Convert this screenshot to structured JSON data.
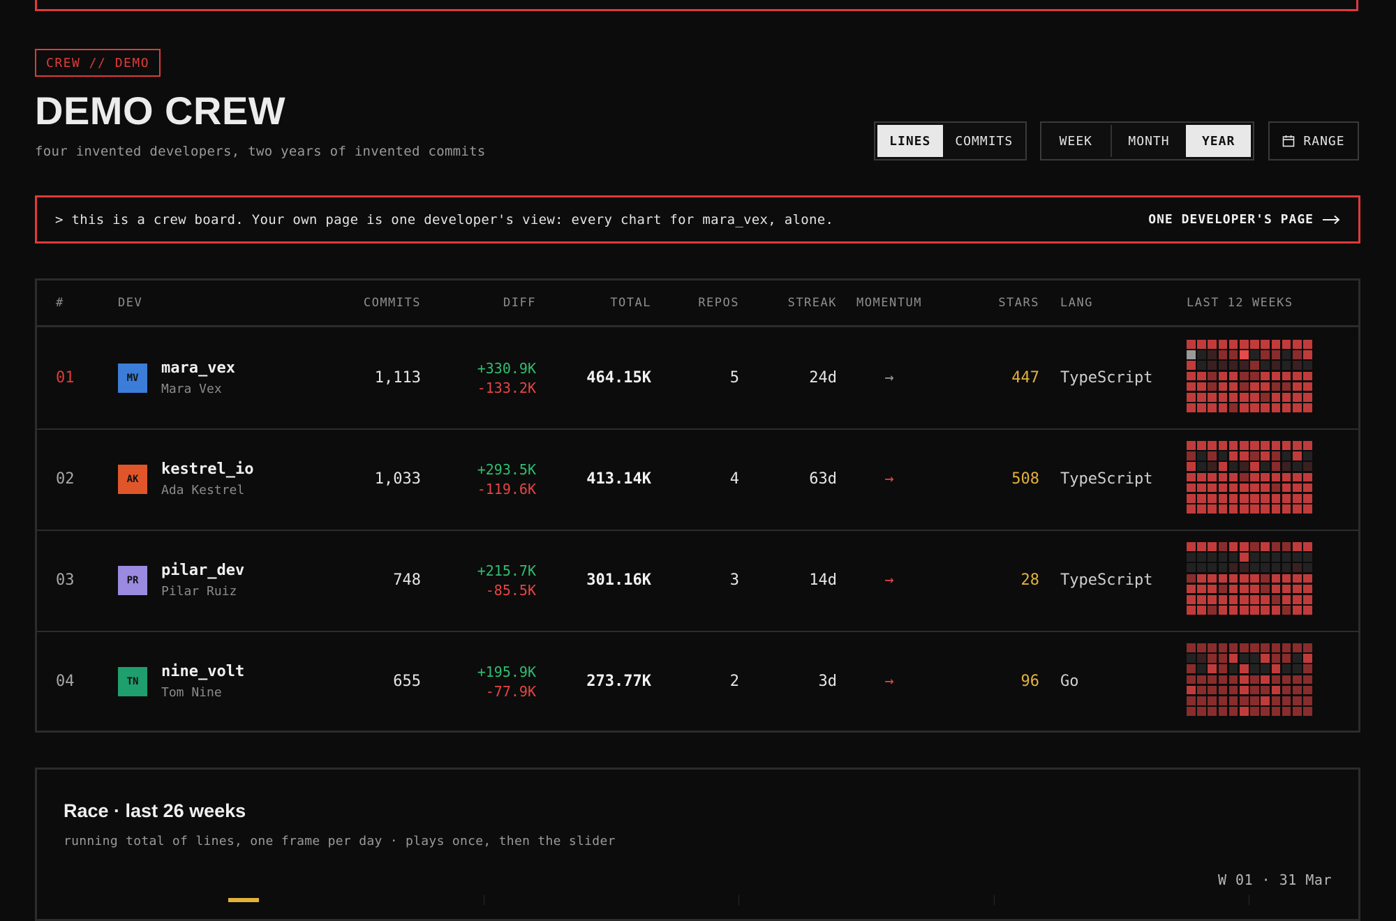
{
  "header": {
    "crumb": "CREW // DEMO",
    "title": "DEMO CREW",
    "subtitle": "four invented developers, two years of invented commits"
  },
  "controls": {
    "metric": {
      "options": [
        "LINES",
        "COMMITS"
      ],
      "selected": "LINES"
    },
    "period": {
      "options": [
        "WEEK",
        "MONTH",
        "YEAR"
      ],
      "selected": "YEAR"
    },
    "range_label": "RANGE",
    "range_icon": "calendar-icon"
  },
  "notice": {
    "text": "> this is a crew board. Your own page is one developer's view: every chart for mara_vex, alone.",
    "link_label": "ONE DEVELOPER'S PAGE",
    "link_icon": "arrow-right-icon"
  },
  "table": {
    "columns": [
      "#",
      "DEV",
      "COMMITS",
      "DIFF",
      "TOTAL",
      "REPOS",
      "STREAK",
      "MOMENTUM",
      "STARS",
      "LANG",
      "LAST 12 WEEKS"
    ],
    "rows": [
      {
        "rank": "01",
        "initials": "MV",
        "avatar_color": "#3b7dd8",
        "username": "mara_vex",
        "name": "Mara Vex",
        "commits": "1,113",
        "added": "+330.9K",
        "removed": "-133.2K",
        "total": "464.15K",
        "repos": "5",
        "streak": "24d",
        "momentum": "→",
        "momentum_color": "#9a9a9a",
        "stars": "447",
        "lang": "TypeScript",
        "heatmap": [
          [
            3,
            3,
            3,
            3,
            3,
            3,
            3,
            3,
            3,
            3,
            3,
            3
          ],
          [
            4,
            0,
            1,
            2,
            2,
            5,
            0,
            2,
            2,
            0,
            2,
            3
          ],
          [
            3,
            0,
            1,
            1,
            1,
            1,
            2,
            0,
            1,
            0,
            1,
            0
          ],
          [
            3,
            3,
            2,
            3,
            3,
            2,
            2,
            3,
            3,
            3,
            3,
            3
          ],
          [
            3,
            3,
            2,
            3,
            3,
            2,
            3,
            3,
            2,
            2,
            3,
            3
          ],
          [
            3,
            3,
            3,
            3,
            3,
            3,
            3,
            2,
            3,
            3,
            3,
            3
          ],
          [
            3,
            3,
            3,
            3,
            2,
            3,
            3,
            3,
            3,
            3,
            3,
            3
          ]
        ]
      },
      {
        "rank": "02",
        "initials": "AK",
        "avatar_color": "#e0562a",
        "username": "kestrel_io",
        "name": "Ada Kestrel",
        "commits": "1,033",
        "added": "+293.5K",
        "removed": "-119.6K",
        "total": "413.14K",
        "repos": "4",
        "streak": "63d",
        "momentum": "→",
        "momentum_color": "#e84545",
        "stars": "508",
        "lang": "TypeScript",
        "heatmap": [
          [
            3,
            3,
            3,
            3,
            3,
            3,
            3,
            3,
            3,
            3,
            3,
            3
          ],
          [
            2,
            0,
            2,
            0,
            3,
            3,
            2,
            3,
            2,
            0,
            3,
            0
          ],
          [
            3,
            0,
            1,
            3,
            0,
            1,
            3,
            0,
            2,
            1,
            0,
            1
          ],
          [
            3,
            3,
            3,
            3,
            3,
            2,
            3,
            3,
            3,
            3,
            3,
            3
          ],
          [
            3,
            3,
            3,
            3,
            3,
            3,
            3,
            3,
            2,
            3,
            3,
            3
          ],
          [
            3,
            3,
            3,
            3,
            3,
            3,
            3,
            3,
            3,
            3,
            3,
            3
          ],
          [
            3,
            3,
            3,
            3,
            3,
            3,
            3,
            3,
            3,
            3,
            3,
            3
          ]
        ]
      },
      {
        "rank": "03",
        "initials": "PR",
        "avatar_color": "#9a8ae0",
        "username": "pilar_dev",
        "name": "Pilar Ruiz",
        "commits": "748",
        "added": "+215.7K",
        "removed": "-85.5K",
        "total": "301.16K",
        "repos": "3",
        "streak": "14d",
        "momentum": "→",
        "momentum_color": "#e84545",
        "stars": "28",
        "lang": "TypeScript",
        "heatmap": [
          [
            3,
            3,
            3,
            2,
            3,
            3,
            2,
            3,
            2,
            2,
            3,
            3
          ],
          [
            0,
            0,
            0,
            0,
            0,
            3,
            0,
            0,
            0,
            0,
            0,
            0
          ],
          [
            0,
            0,
            0,
            0,
            1,
            1,
            0,
            0,
            0,
            0,
            1,
            0
          ],
          [
            2,
            3,
            3,
            3,
            3,
            3,
            3,
            2,
            3,
            3,
            3,
            3
          ],
          [
            3,
            3,
            3,
            2,
            3,
            3,
            3,
            2,
            3,
            3,
            3,
            3
          ],
          [
            3,
            3,
            3,
            3,
            3,
            3,
            3,
            3,
            2,
            3,
            3,
            3
          ],
          [
            3,
            3,
            2,
            3,
            3,
            3,
            3,
            3,
            3,
            2,
            3,
            3
          ]
        ]
      },
      {
        "rank": "04",
        "initials": "TN",
        "avatar_color": "#1f9e6e",
        "username": "nine_volt",
        "name": "Tom Nine",
        "commits": "655",
        "added": "+195.9K",
        "removed": "-77.9K",
        "total": "273.77K",
        "repos": "2",
        "streak": "3d",
        "momentum": "→",
        "momentum_color": "#e84545",
        "stars": "96",
        "lang": "Go",
        "heatmap": [
          [
            2,
            2,
            2,
            2,
            2,
            2,
            2,
            2,
            2,
            2,
            2,
            2
          ],
          [
            0,
            1,
            2,
            2,
            3,
            0,
            0,
            3,
            2,
            2,
            0,
            3
          ],
          [
            2,
            0,
            3,
            2,
            0,
            3,
            0,
            0,
            3,
            0,
            0,
            2
          ],
          [
            2,
            2,
            2,
            2,
            2,
            3,
            2,
            3,
            2,
            2,
            2,
            2
          ],
          [
            3,
            2,
            2,
            2,
            2,
            3,
            2,
            2,
            3,
            2,
            2,
            2
          ],
          [
            2,
            2,
            2,
            2,
            2,
            2,
            2,
            3,
            2,
            2,
            2,
            2
          ],
          [
            2,
            2,
            2,
            2,
            2,
            3,
            2,
            2,
            2,
            2,
            2,
            2
          ]
        ]
      }
    ]
  },
  "heat_colors": [
    "#222222",
    "#3a2020",
    "#8a2c2c",
    "#c23b3b",
    "#9a9a9a",
    "#e64a4a"
  ],
  "race": {
    "title": "Race · last 26 weeks",
    "subtitle": "running total of lines, one frame per day · plays once, then the slider",
    "frame_label": "W 01 · 31 Mar",
    "bar_color": "#e3b23c"
  },
  "colors": {
    "accent": "#e03a3a",
    "positive": "#2fbf71",
    "negative": "#e84545",
    "stars": "#e3b23c"
  }
}
